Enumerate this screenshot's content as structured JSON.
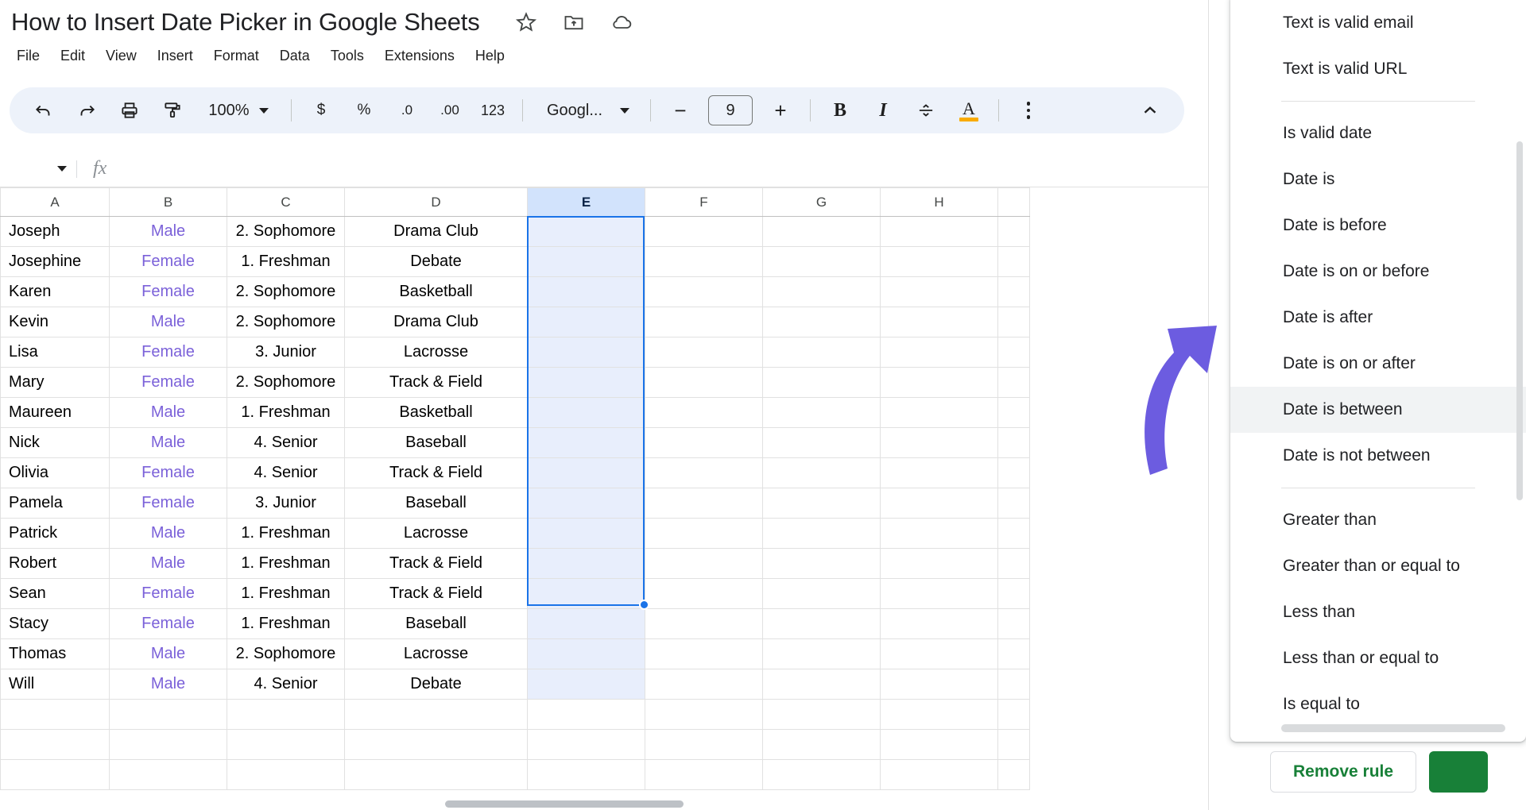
{
  "document": {
    "title": "How to Insert Date Picker in Google Sheets",
    "title_icons": [
      "star-icon",
      "move-to-folder-icon",
      "cloud-saved-icon"
    ]
  },
  "menubar": {
    "items": [
      "File",
      "Edit",
      "View",
      "Insert",
      "Format",
      "Data",
      "Tools",
      "Extensions",
      "Help"
    ]
  },
  "toolbar": {
    "undo": "undo-icon",
    "redo": "redo-icon",
    "print": "print-icon",
    "paint_format": "paint-format-icon",
    "zoom_value": "100%",
    "currency": "$",
    "percent": "%",
    "decrease_decimal": ".0",
    "increase_decimal": ".00",
    "more_formats": "123",
    "font_name": "Googl...",
    "font_size_decrease": "−",
    "font_size": "9",
    "font_size_increase": "+",
    "bold": "B",
    "italic": "I",
    "strikethrough": "strikethrough-icon",
    "text_color": "A",
    "text_color_swatch": "#f9ab00",
    "more_options": "three-dots-icon",
    "collapse": "chevron-up-icon"
  },
  "formula_bar": {
    "name_box_value": "",
    "fx_label": "fx",
    "formula_value": ""
  },
  "grid": {
    "columns": [
      "A",
      "B",
      "C",
      "D",
      "E",
      "F",
      "G",
      "H"
    ],
    "selected_column": "E",
    "rows": [
      {
        "a": "Joseph",
        "b": "Male",
        "c": "2. Sophomore",
        "d": "Drama Club"
      },
      {
        "a": "Josephine",
        "b": "Female",
        "c": "1. Freshman",
        "d": "Debate"
      },
      {
        "a": "Karen",
        "b": "Female",
        "c": "2. Sophomore",
        "d": "Basketball"
      },
      {
        "a": "Kevin",
        "b": "Male",
        "c": "2. Sophomore",
        "d": "Drama Club"
      },
      {
        "a": "Lisa",
        "b": "Female",
        "c": "3. Junior",
        "d": "Lacrosse"
      },
      {
        "a": "Mary",
        "b": "Female",
        "c": "2. Sophomore",
        "d": "Track & Field"
      },
      {
        "a": "Maureen",
        "b": "Male",
        "c": "1. Freshman",
        "d": "Basketball"
      },
      {
        "a": "Nick",
        "b": "Male",
        "c": "4. Senior",
        "d": "Baseball"
      },
      {
        "a": "Olivia",
        "b": "Female",
        "c": "4. Senior",
        "d": "Track & Field"
      },
      {
        "a": "Pamela",
        "b": "Female",
        "c": "3. Junior",
        "d": "Baseball"
      },
      {
        "a": "Patrick",
        "b": "Male",
        "c": "1. Freshman",
        "d": "Lacrosse"
      },
      {
        "a": "Robert",
        "b": "Male",
        "c": "1. Freshman",
        "d": "Track & Field"
      },
      {
        "a": "Sean",
        "b": "Female",
        "c": "1. Freshman",
        "d": "Track & Field"
      },
      {
        "a": "Stacy",
        "b": "Female",
        "c": "1. Freshman",
        "d": "Baseball"
      },
      {
        "a": "Thomas",
        "b": "Male",
        "c": "2. Sophomore",
        "d": "Lacrosse"
      },
      {
        "a": "Will",
        "b": "Male",
        "c": "4. Senior",
        "d": "Debate"
      }
    ]
  },
  "criteria_dropdown": {
    "active_item": "Date is between",
    "groups": [
      {
        "items": [
          "Text is valid email",
          "Text is valid URL"
        ]
      },
      {
        "items": [
          "Is valid date",
          "Date is",
          "Date is before",
          "Date is on or before",
          "Date is after",
          "Date is on or after",
          "Date is between",
          "Date is not between"
        ]
      },
      {
        "items": [
          "Greater than",
          "Greater than or equal to",
          "Less than",
          "Less than or equal to",
          "Is equal to"
        ]
      }
    ]
  },
  "panel_actions": {
    "remove_rule": "Remove rule",
    "done": "",
    "remove_rule_color": "#188038",
    "done_color": "#188038"
  },
  "annotation": {
    "arrow": "curved-arrow-annotation",
    "arrow_color": "#6c5ce0"
  }
}
